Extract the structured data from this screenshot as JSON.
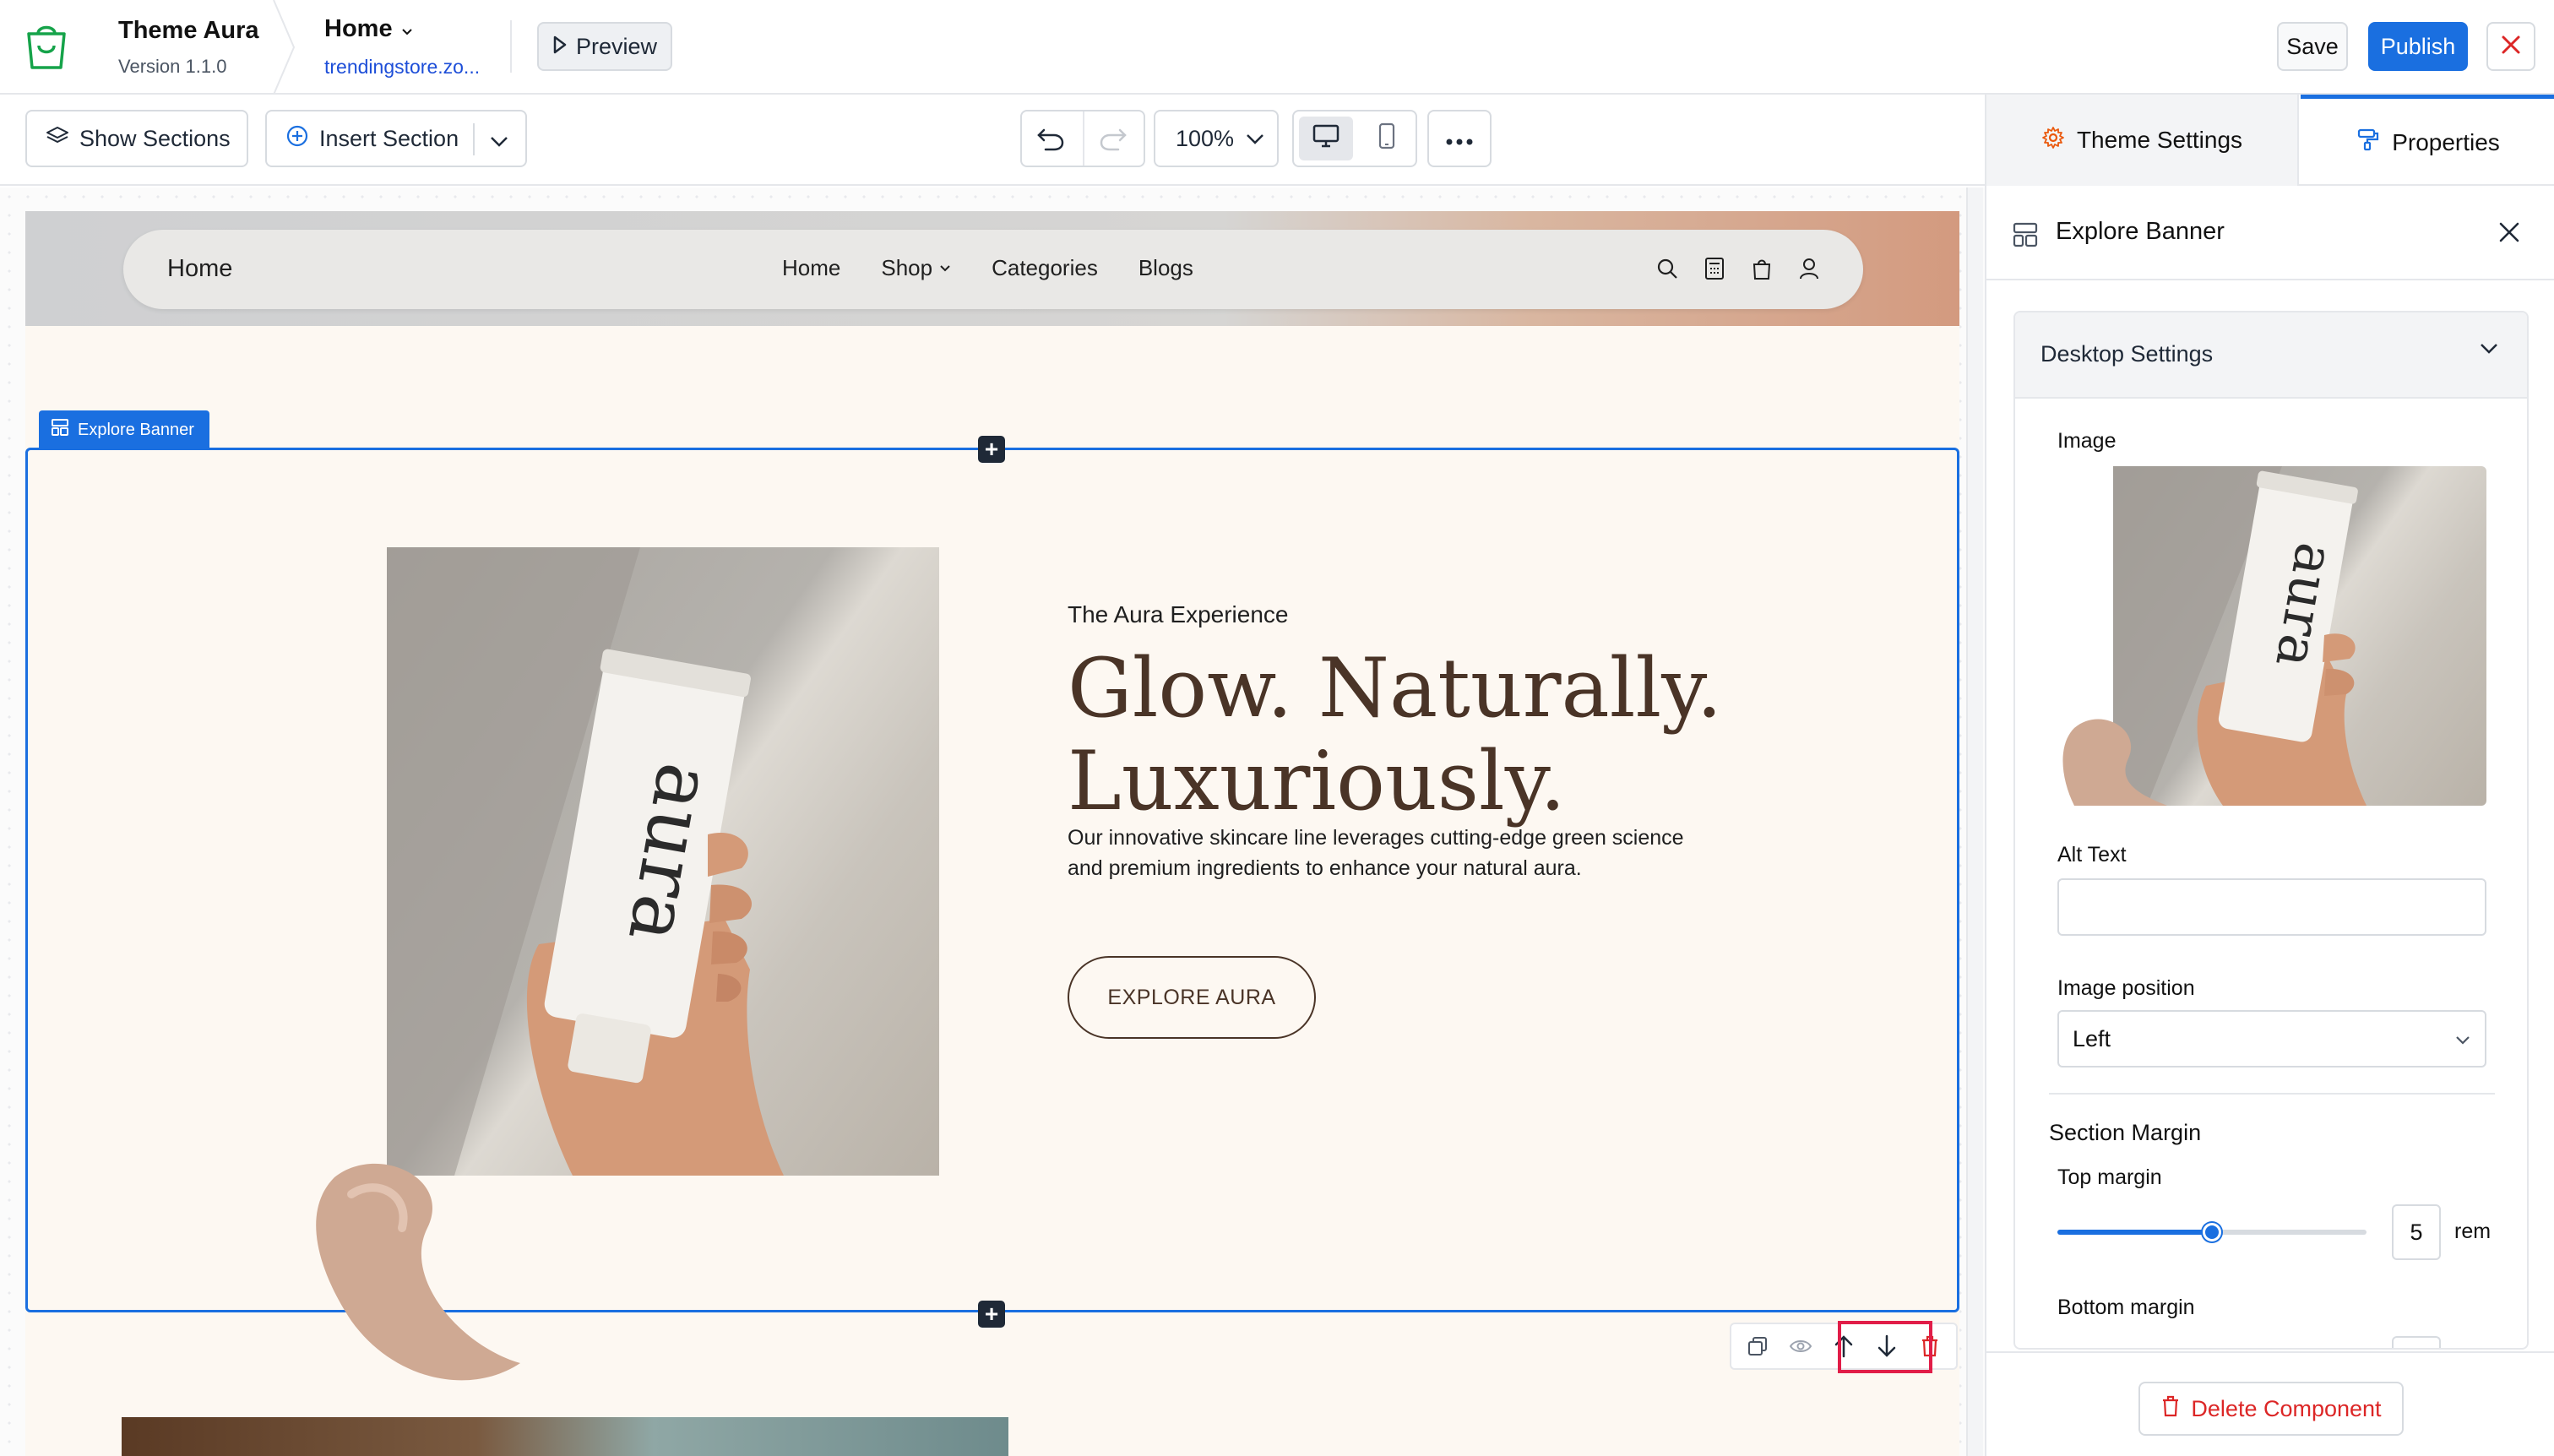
{
  "header": {
    "theme_name": "Theme Aura",
    "version": "Version 1.1.0",
    "page_name": "Home",
    "store_url": "trendingstore.zo...",
    "preview_label": "Preview",
    "save_label": "Save",
    "publish_label": "Publish"
  },
  "toolbar": {
    "show_sections_label": "Show Sections",
    "insert_section_label": "Insert Section",
    "zoom_value": "100%"
  },
  "site": {
    "logo_text": "Home",
    "menu": [
      "Home",
      "Shop",
      "Categories",
      "Blogs"
    ],
    "icons": [
      "search-icon",
      "calculator-icon",
      "shopping-bag-icon",
      "user-icon"
    ]
  },
  "section": {
    "badge_label": "Explore Banner",
    "eyebrow": "The Aura Experience",
    "headline_line1": "Glow. Naturally.",
    "headline_line2": "Luxuriously.",
    "body": "Our innovative skincare line leverages cutting-edge green science and premium ingredients to enhance your natural aura.",
    "cta_label": "EXPLORE AURA",
    "tube_brand": "aura"
  },
  "panel": {
    "tab_theme_settings": "Theme Settings",
    "tab_properties": "Properties",
    "title": "Explore Banner",
    "card_title": "Desktop Settings",
    "image_label": "Image",
    "alt_text_label": "Alt Text",
    "alt_text_value": "",
    "image_position_label": "Image position",
    "image_position_value": "Left",
    "section_margin_label": "Section Margin",
    "top_margin_label": "Top margin",
    "top_margin_value": "5",
    "top_margin_unit": "rem",
    "top_margin_fraction": 0.5,
    "bottom_margin_label": "Bottom margin",
    "delete_label": "Delete Component"
  },
  "colors": {
    "accent": "#1a6fe0",
    "highlight": "#e11d48",
    "danger": "#dc2626",
    "site_background": "#fdf8f2",
    "headline": "#4a3427"
  }
}
